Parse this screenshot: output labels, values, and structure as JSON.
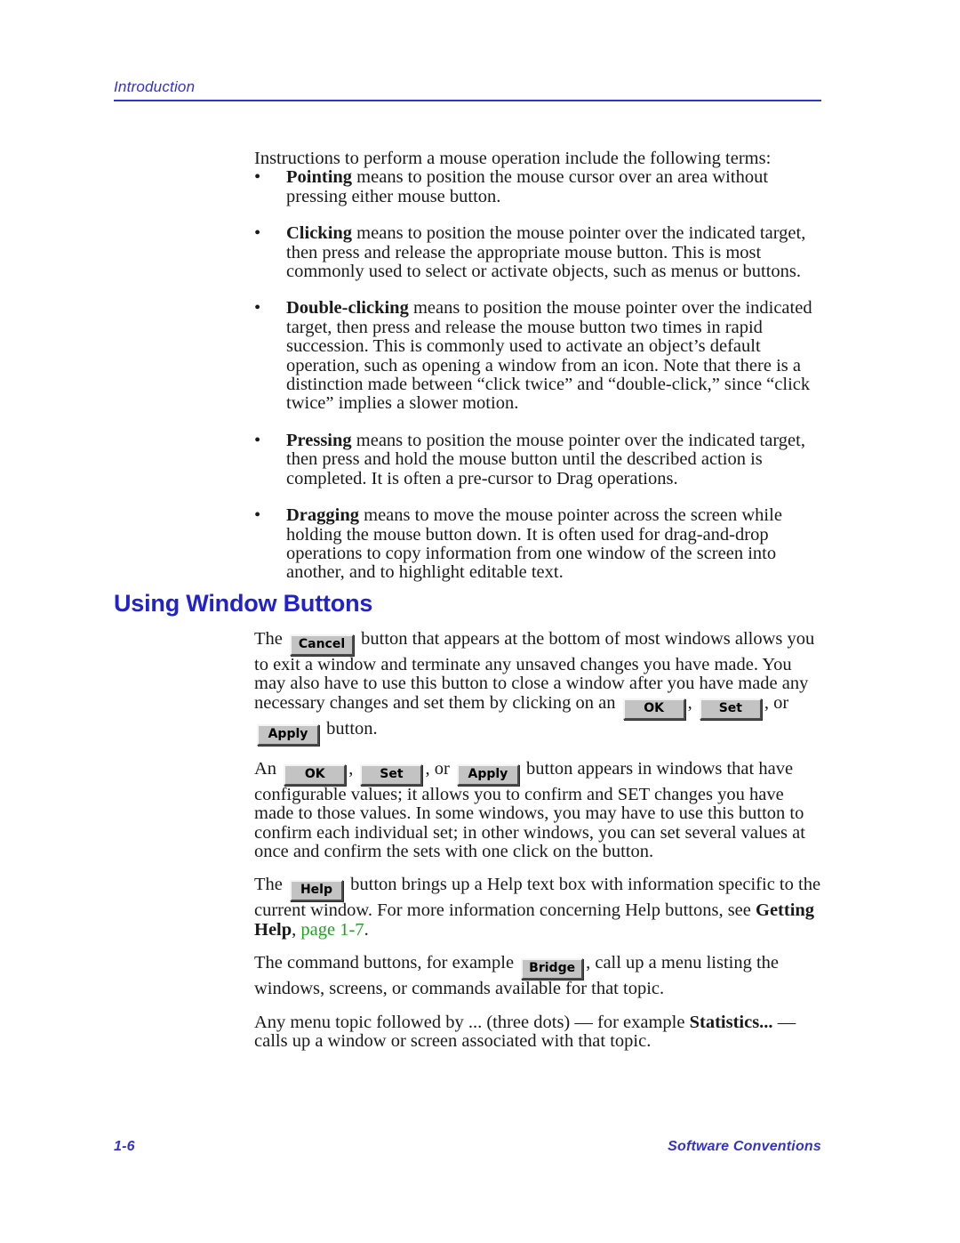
{
  "header": {
    "running_head": "Introduction"
  },
  "intro": {
    "lead": "Instructions to perform a mouse operation include the following terms:",
    "bullet_marker": "•",
    "bullets": [
      {
        "term": "Pointing",
        "text": " means to position the mouse cursor over an area without pressing either mouse button."
      },
      {
        "term": "Clicking",
        "text": " means to position the mouse pointer over the indicated target, then press and release the appropriate mouse button. This is most commonly used to select or activate objects, such as menus or buttons."
      },
      {
        "term": "Double-clicking",
        "text": " means to position the mouse pointer over the indicated target, then press and release the mouse button two times in rapid succession. This is commonly used to activate an object’s default operation, such as opening a window from an icon. Note that there is a distinction made between “click twice” and “double-click,” since “click twice” implies a slower motion."
      },
      {
        "term": "Pressing",
        "text": " means to position the mouse pointer over the indicated target, then press and hold the mouse button until the described action is completed. It is often a pre-cursor to Drag operations."
      },
      {
        "term": "Dragging",
        "text": " means to move the mouse pointer across the screen while holding the mouse button down. It is often used for drag-and-drop operations to copy information from one window of the screen into another, and to highlight editable text."
      }
    ]
  },
  "section": {
    "heading": "Using Window Buttons",
    "cancel_para": {
      "before": "The",
      "button": "Cancel",
      "after_1": "button that appears at the bottom of most windows allows you to exit a window and terminate any unsaved changes you have made. You may also have to use this button to close a window after you have made any necessary changes and set them by clicking on an",
      "btn_ok": "OK",
      "sep_comma": ",",
      "btn_set": "Set",
      "sep_or": ", or",
      "btn_apply": "Apply",
      "tail": "button."
    },
    "confirm_para": {
      "before": "An",
      "btn_ok": "OK",
      "sep_comma": ",",
      "btn_set": "Set",
      "sep_or": ", or",
      "btn_apply": "Apply",
      "after": "button appears in windows that have configurable values; it allows you to confirm and SET changes you have made to those values. In some windows, you may have to use this button to confirm each individual set; in other windows, you can set several values at once and confirm the sets with one click on the button."
    },
    "help_para": {
      "before": "The",
      "button": "Help",
      "after": "button brings up a Help text box with information specific to the current window. For more information concerning Help buttons, see",
      "ref_bold": "Getting Help",
      "ref_comma": ",",
      "ref_link": "page 1-7",
      "ref_period": "."
    },
    "command_para": {
      "before": "The command buttons, for example",
      "button": "Bridge",
      "after": ", call up a menu listing the windows, screens, or commands available for that topic."
    },
    "menu_para": {
      "before": "Any menu topic followed by ... (three dots) — for example",
      "bold": "Statistics...",
      "after": "— calls up a window or screen associated with that topic."
    }
  },
  "footer": {
    "page_number": "1-6",
    "section_title": "Software Conventions"
  },
  "colors": {
    "accent_blue": "#3333cc",
    "heading_blue": "#2222cc",
    "xref_green": "#1aa51a",
    "button_face": "#c3c3c3",
    "button_light": "#f4f4f4",
    "button_shadow": "#4a4a4a"
  }
}
